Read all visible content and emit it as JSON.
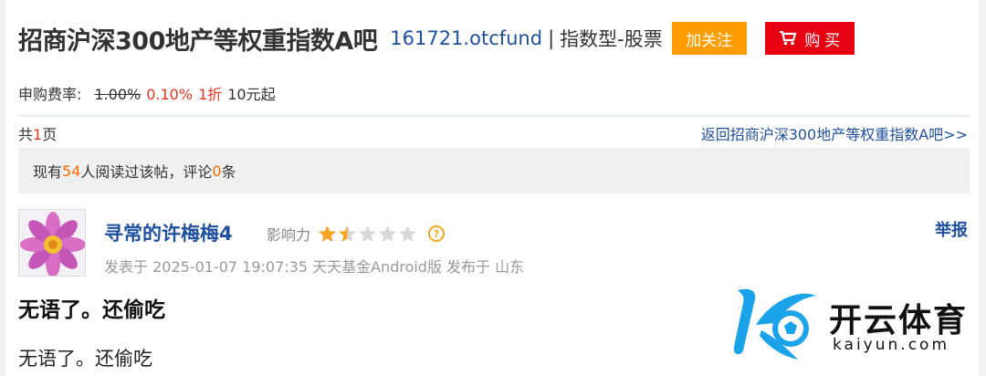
{
  "header": {
    "bar_name": "招商沪深300地产等权重指数A吧",
    "fund_code": "161721.otcfund",
    "separator": "|",
    "fund_type": "指数型-股票",
    "follow_label": "加关注",
    "buy_label": "购 买"
  },
  "fee": {
    "label": "申购费率:",
    "original": "1.00%",
    "discounted": "0.10%",
    "discount": "1折",
    "minimum": "10元起"
  },
  "pager": {
    "prefix": "共",
    "pages": "1",
    "suffix": "页",
    "back_link": "返回招商沪深300地产等权重指数A吧>>"
  },
  "stats": {
    "prefix": "现有",
    "readers": "54",
    "mid": "人阅读过该帖，评论",
    "comments": "0",
    "suffix": "条"
  },
  "post": {
    "username": "寻常的许梅梅4",
    "influence_label": "影响力",
    "rating": 1.5,
    "rating_max": 5,
    "help_mark": "?",
    "report_label": "举报",
    "meta": "发表于 2025-01-07 19:07:35 天天基金Android版 发布于 山东",
    "title": "无语了。还偷吃",
    "body": "无语了。还偷吃"
  },
  "watermark": {
    "name": "开云体育",
    "domain": "kaiyun.com"
  },
  "colors": {
    "link_blue": "#1f4f9f",
    "follow_orange": "#ff9d00",
    "buy_red": "#e60012",
    "highlight_red": "#e8341e",
    "star_gold": "#f5a623"
  }
}
